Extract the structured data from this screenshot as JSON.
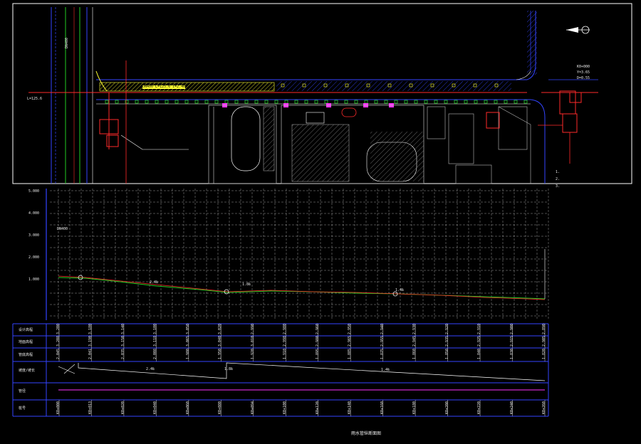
{
  "colors": {
    "background": "#000000",
    "frame": "#ffffff",
    "grid": "#9a9a9a",
    "road_blue": "#3344ff",
    "road_red": "#ff2a2a",
    "green": "#22cc22",
    "yellow": "#ffff33",
    "magenta": "#ff33ff",
    "cyan": "#33ffff",
    "grey": "#bbbbbb"
  },
  "plan": {
    "notes_top_right": [
      "K0+000",
      "Y=3.65",
      "D=0.55"
    ],
    "notes_left": [
      "DN400",
      "L=125.6"
    ],
    "hatch_label": "DN400 L=125.6 i=2.4‰",
    "right_notes": [
      "1.",
      "2.",
      "3."
    ]
  },
  "profile": {
    "elevation_ticks": [
      "5.000",
      "4.000",
      "3.000",
      "2.000",
      "1.000"
    ],
    "callout_left_top": "DN400",
    "slope_labels": [
      "2.4‰",
      "1.8‰",
      "1.4‰"
    ]
  },
  "table": {
    "row_headers": [
      "设计高程",
      "地面高程",
      "管底高程",
      "坡度/坡长",
      "管径",
      "桩号"
    ],
    "columns": [
      {
        "design": "3.200",
        "ground": "3.208",
        "bottom": "2.045",
        "station": "K0+000"
      },
      {
        "design": "3.180",
        "ground": "3.190",
        "bottom": "2.041",
        "station": "K0+013"
      },
      {
        "design": "3.140",
        "ground": "3.150",
        "bottom": "2.035",
        "station": "K0+020"
      },
      {
        "design": "3.100",
        "ground": "3.118",
        "bottom": "2.008",
        "station": "K0+040"
      },
      {
        "design": "3.050",
        "ground": "3.065",
        "bottom": "1.980",
        "station": "K0+060"
      },
      {
        "design": "3.020",
        "ground": "3.040",
        "bottom": "1.950",
        "station": "K0+080"
      },
      {
        "design": "2.990",
        "ground": "3.010",
        "bottom": "1.920",
        "station": "K0+094"
      },
      {
        "design": "2.980",
        "ground": "2.998",
        "bottom": "1.910",
        "station": "K0+100"
      },
      {
        "design": "2.960",
        "ground": "2.980",
        "bottom": "1.895",
        "station": "K0+120"
      },
      {
        "design": "2.950",
        "ground": "2.965",
        "bottom": "1.885",
        "station": "K0+140"
      },
      {
        "design": "2.940",
        "ground": "2.955",
        "bottom": "1.875",
        "station": "K0+160"
      },
      {
        "design": "2.930",
        "ground": "2.945",
        "bottom": "1.860",
        "station": "K0+180"
      },
      {
        "design": "2.920",
        "ground": "2.935",
        "bottom": "1.850",
        "station": "K0+200"
      },
      {
        "design": "2.910",
        "ground": "2.925",
        "bottom": "1.840",
        "station": "K0+220"
      },
      {
        "design": "2.900",
        "ground": "2.915",
        "bottom": "1.830",
        "station": "K0+240"
      },
      {
        "design": "2.890",
        "ground": "2.905",
        "bottom": "1.820",
        "station": "K0+260"
      }
    ],
    "slopes": [
      {
        "text": "2.4‰"
      },
      {
        "text": "1.8‰"
      },
      {
        "text": "1.4‰"
      }
    ],
    "footer_title": "雨水管纵断面图"
  }
}
